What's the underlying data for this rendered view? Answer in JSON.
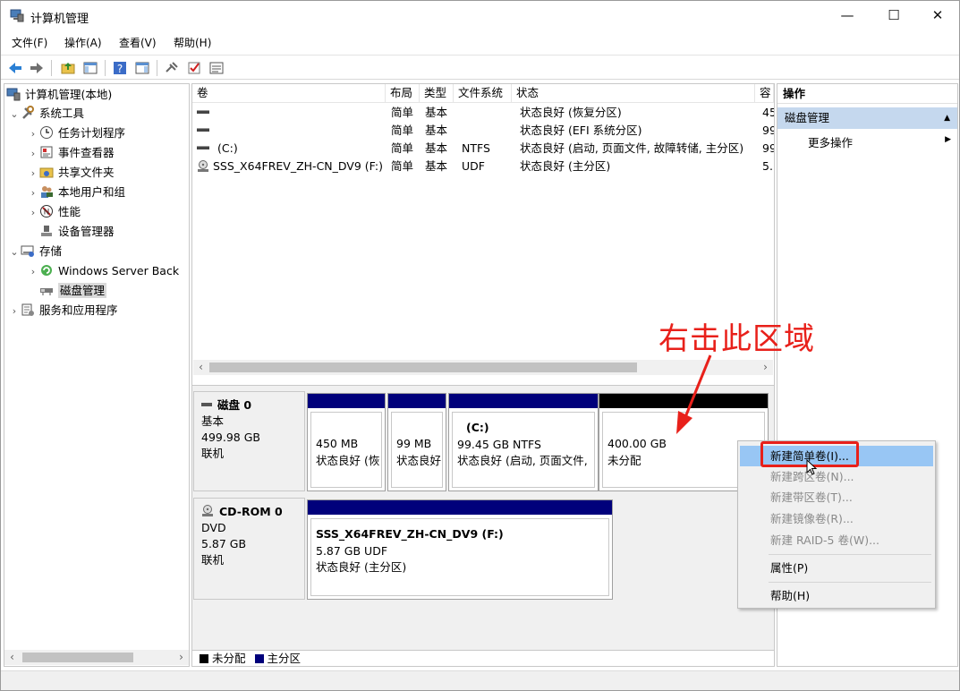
{
  "window": {
    "title": "计算机管理",
    "minimize": "—",
    "maximize": "☐",
    "close": "✕"
  },
  "menu": [
    "文件(F)",
    "操作(A)",
    "查看(V)",
    "帮助(H)"
  ],
  "tree": {
    "root": "计算机管理(本地)",
    "system_tools": "系统工具",
    "task_scheduler": "任务计划程序",
    "event_viewer": "事件查看器",
    "shared_folders": "共享文件夹",
    "local_users": "本地用户和组",
    "performance": "性能",
    "device_manager": "设备管理器",
    "storage": "存储",
    "windows_backup": "Windows Server Back",
    "disk_management": "磁盘管理",
    "services_apps": "服务和应用程序"
  },
  "volumes": {
    "columns": [
      "卷",
      "布局",
      "类型",
      "文件系统",
      "状态",
      "容"
    ],
    "rows": [
      {
        "name": "",
        "layout": "简单",
        "type": "基本",
        "fs": "",
        "status": "状态良好 (恢复分区)",
        "cap": "45"
      },
      {
        "name": "",
        "layout": "简单",
        "type": "基本",
        "fs": "",
        "status": "状态良好 (EFI 系统分区)",
        "cap": "99"
      },
      {
        "name": "(C:)",
        "layout": "简单",
        "type": "基本",
        "fs": "NTFS",
        "status": "状态良好 (启动, 页面文件, 故障转储, 主分区)",
        "cap": "99"
      },
      {
        "name": "SSS_X64FREV_ZH-CN_DV9 (F:)",
        "layout": "简单",
        "type": "基本",
        "fs": "UDF",
        "status": "状态良好 (主分区)",
        "cap": "5."
      }
    ]
  },
  "disk0": {
    "name": "磁盘 0",
    "type": "基本",
    "size": "499.98 GB",
    "state": "联机",
    "partitions": [
      {
        "label": "",
        "size": "450 MB",
        "status": "状态良好 (恢"
      },
      {
        "label": "",
        "size": "99 MB",
        "status": "状态良好"
      },
      {
        "label": "(C:)",
        "size": "99.45 GB NTFS",
        "status": "状态良好 (启动, 页面文件,"
      },
      {
        "label": "",
        "size": "400.00 GB",
        "status": "未分配"
      }
    ]
  },
  "cdrom0": {
    "name": "CD-ROM 0",
    "type": "DVD",
    "size": "5.87 GB",
    "state": "联机",
    "partition": {
      "label": "SSS_X64FREV_ZH-CN_DV9  (F:)",
      "size": "5.87 GB UDF",
      "status": "状态良好 (主分区)"
    }
  },
  "legend": {
    "unallocated": "未分配",
    "primary": "主分区"
  },
  "actions": {
    "header": "操作",
    "section": "磁盘管理",
    "more": "更多操作"
  },
  "context_menu": {
    "new_simple": "新建简单卷(I)...",
    "new_spanned": "新建跨区卷(N)...",
    "new_striped": "新建带区卷(T)...",
    "new_mirrored": "新建镜像卷(R)...",
    "new_raid5": "新建 RAID-5 卷(W)...",
    "properties": "属性(P)",
    "help": "帮助(H)"
  },
  "annotation": "右击此区域",
  "colors": {
    "primary_partition": "#00007b",
    "unallocated": "#000000",
    "highlight": "#98c6f4",
    "annotation_red": "#e8201a"
  }
}
